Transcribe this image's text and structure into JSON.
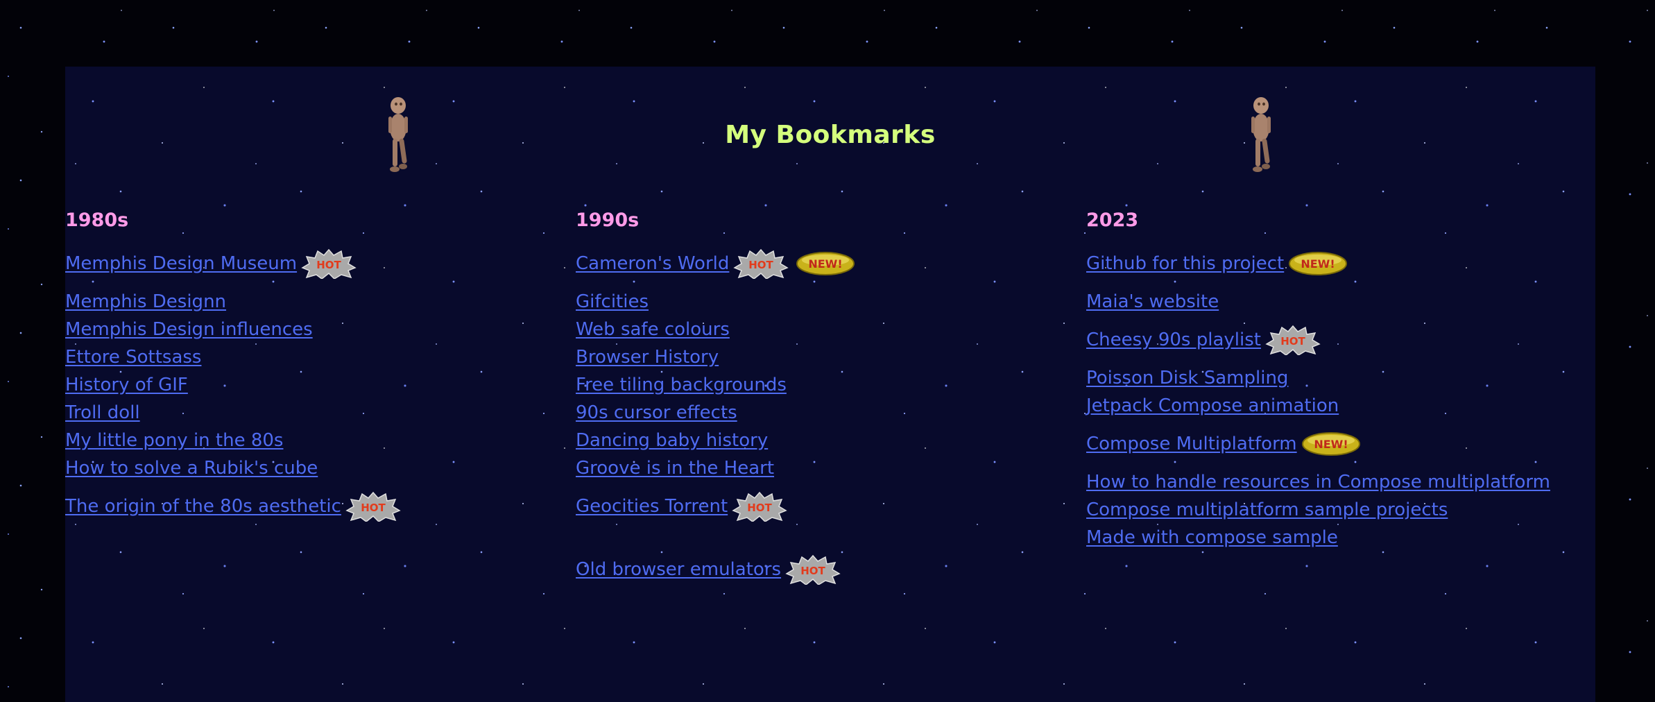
{
  "page": {
    "title": "My Bookmarks",
    "heading_color": "#d5ff7d",
    "column_heading_color": "#ff9be8",
    "link_color": "#4f6cf2",
    "decoration_icon": "dancing-baby-icon"
  },
  "badges": {
    "hot": "HOT",
    "new": "NEW!"
  },
  "columns": [
    {
      "heading": "1980s",
      "links": [
        {
          "label": "Memphis Design Museum",
          "badges": [
            "hot"
          ]
        },
        {
          "label": "Memphis Designn",
          "badges": []
        },
        {
          "label": "Memphis Design influences",
          "badges": []
        },
        {
          "label": "Ettore Sottsass",
          "badges": []
        },
        {
          "label": "History of GIF",
          "badges": []
        },
        {
          "label": "Troll doll",
          "badges": []
        },
        {
          "label": "My little pony in the 80s",
          "badges": []
        },
        {
          "label": "How to solve a Rubik's cube",
          "badges": []
        },
        {
          "label": "The origin of the 80s aesthetic",
          "badges": [
            "hot"
          ]
        }
      ]
    },
    {
      "heading": "1990s",
      "links": [
        {
          "label": "Cameron's World",
          "badges": [
            "hot",
            "new"
          ]
        },
        {
          "label": "Gifcities",
          "badges": []
        },
        {
          "label": "Web safe colours",
          "badges": []
        },
        {
          "label": "Browser History",
          "badges": []
        },
        {
          "label": "Free tiling backgrounds",
          "badges": []
        },
        {
          "label": "90s cursor effects",
          "badges": []
        },
        {
          "label": "Dancing baby history",
          "badges": []
        },
        {
          "label": "Groove is in the Heart",
          "badges": []
        },
        {
          "label": "Geocities Torrent",
          "badges": [
            "hot"
          ]
        },
        {
          "label": "Old browser emulators",
          "badges": [
            "hot"
          ]
        }
      ]
    },
    {
      "heading": "2023",
      "links": [
        {
          "label": "Github for this project",
          "badges": [
            "new"
          ]
        },
        {
          "label": "Maia's website",
          "badges": []
        },
        {
          "label": "Cheesy 90s playlist",
          "badges": [
            "hot"
          ]
        },
        {
          "label": "Poisson Disk Sampling",
          "badges": []
        },
        {
          "label": "Jetpack Compose animation",
          "badges": []
        },
        {
          "label": "Compose Multiplatform",
          "badges": [
            "new"
          ]
        },
        {
          "label": "How to handle resources in Compose multiplatform",
          "badges": []
        },
        {
          "label": "Compose multiplatform sample projects",
          "badges": []
        },
        {
          "label": "Made with compose sample",
          "badges": []
        }
      ]
    }
  ]
}
